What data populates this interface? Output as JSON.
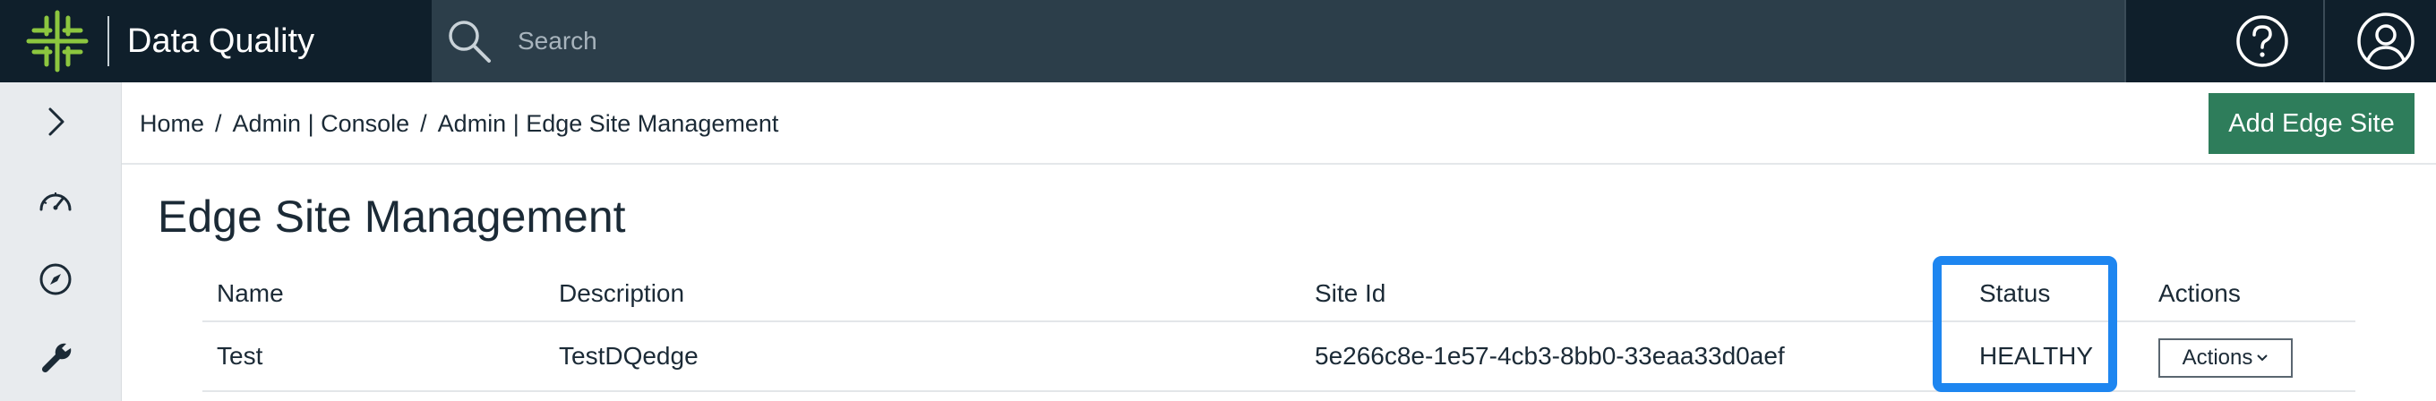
{
  "header": {
    "app_title": "Data Quality",
    "search_placeholder": "Search",
    "logo_color": "#8cc63f",
    "help_icon": "help-circle-icon",
    "user_icon": "user-circle-icon"
  },
  "sidebar": {
    "items": [
      {
        "name": "expand",
        "icon": "chevron-right-icon"
      },
      {
        "name": "dashboard",
        "icon": "gauge-icon"
      },
      {
        "name": "explore",
        "icon": "compass-icon"
      },
      {
        "name": "admin",
        "icon": "wrench-icon"
      }
    ]
  },
  "breadcrumb": {
    "items": [
      "Home",
      "Admin | Console",
      "Admin | Edge Site Management"
    ],
    "separator": "/"
  },
  "toolbar": {
    "add_label": "Add Edge Site",
    "accent": "#2e7d5b"
  },
  "page": {
    "title": "Edge Site Management"
  },
  "table": {
    "columns": [
      "Name",
      "Description",
      "Site Id",
      "Status",
      "Actions"
    ],
    "rows": [
      {
        "name": "Test",
        "description": "TestDQedge",
        "site_id": "5e266c8e-1e57-4cb3-8bb0-33eaa33d0aef",
        "status": "HEALTHY",
        "actions_label": "Actions"
      }
    ]
  },
  "highlight_color": "#1e86f0"
}
